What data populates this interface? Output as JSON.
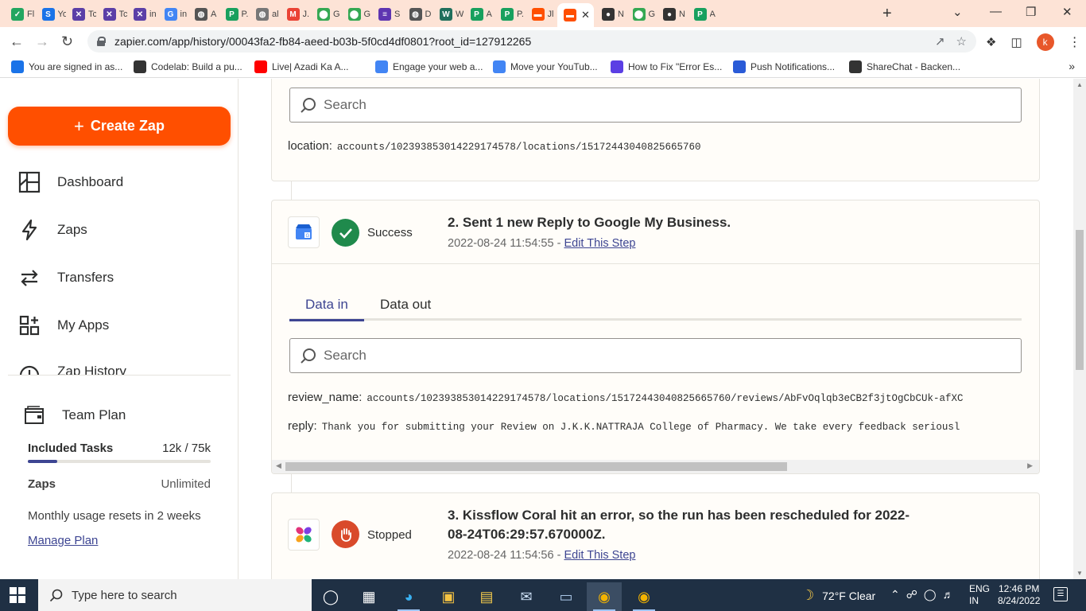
{
  "browser": {
    "tabs": [
      {
        "label": "Fl",
        "icon": "check-icon",
        "color": "#22a660"
      },
      {
        "label": "Yo",
        "icon": "s-logo-icon",
        "color": "#1a73e8"
      },
      {
        "label": "Tc",
        "icon": "crossed-icon",
        "color": "#5b3fa7"
      },
      {
        "label": "Tc",
        "icon": "crossed-icon",
        "color": "#5b3fa7"
      },
      {
        "label": "in",
        "icon": "crossed-icon",
        "color": "#5b3fa7"
      },
      {
        "label": "in",
        "icon": "google-icon",
        "color": "#4285f4"
      },
      {
        "label": "A",
        "icon": "globe-icon",
        "color": "#555555"
      },
      {
        "label": "P.",
        "icon": "p-logo-icon",
        "color": "#18a05e"
      },
      {
        "label": "al",
        "icon": "globe-icon",
        "color": "#777777"
      },
      {
        "label": "J.",
        "icon": "gmail-icon",
        "color": "#ea4335"
      },
      {
        "label": "G",
        "icon": "maps-icon",
        "color": "#34a853"
      },
      {
        "label": "G",
        "icon": "maps-icon",
        "color": "#34a853"
      },
      {
        "label": "S",
        "icon": "list-icon",
        "color": "#5e35b1"
      },
      {
        "label": "D",
        "icon": "globe-icon",
        "color": "#555555"
      },
      {
        "label": "W",
        "icon": "w-logo-icon",
        "color": "#1f6f5c"
      },
      {
        "label": "A",
        "icon": "p-logo-icon",
        "color": "#18a05e"
      },
      {
        "label": "P.",
        "icon": "p-logo-icon",
        "color": "#18a05e"
      },
      {
        "label": "Jl",
        "icon": "zapier-icon",
        "color": "#ff4f00"
      }
    ],
    "active_tab": {
      "icon": "zapier-icon",
      "color": "#ff4f00"
    },
    "tabs_right": [
      {
        "label": "N",
        "icon": "github-icon",
        "color": "#333333"
      },
      {
        "label": "G",
        "icon": "maps-icon",
        "color": "#34a853"
      },
      {
        "label": "N",
        "icon": "github-icon",
        "color": "#333333"
      },
      {
        "label": "A",
        "icon": "p-logo-icon",
        "color": "#18a05e"
      }
    ],
    "url": "zapier.com/app/history/00043fa2-fb84-aeed-b03b-5f0cd4df0801?root_id=127912265",
    "profile_letter": "k",
    "bookmarks": [
      {
        "label": "You are signed in as...",
        "color": "#1a73e8"
      },
      {
        "label": "Codelab: Build a pu...",
        "color": "#333333"
      },
      {
        "label": "Live| Azadi Ka A...",
        "color": "#ff0000"
      },
      {
        "label": "Engage your web a...",
        "color": "#4285f4"
      },
      {
        "label": "Move your YouTub...",
        "color": "#4285f4"
      },
      {
        "label": "How to Fix \"Error Es...",
        "color": "#5b3fe4"
      },
      {
        "label": "Push Notifications...",
        "color": "#2a5bd7"
      },
      {
        "label": "ShareChat - Backen...",
        "color": "#333333"
      }
    ]
  },
  "sidebar": {
    "create_label": "Create Zap",
    "nav": [
      {
        "label": "Dashboard",
        "icon": "dashboard-icon"
      },
      {
        "label": "Zaps",
        "icon": "bolt-icon"
      },
      {
        "label": "Transfers",
        "icon": "transfer-icon"
      },
      {
        "label": "My Apps",
        "icon": "apps-icon"
      },
      {
        "label": "Zap History",
        "icon": "history-icon"
      }
    ],
    "plan": {
      "title": "Team Plan",
      "tasks_label": "Included Tasks",
      "tasks_value": "12k / 75k",
      "tasks_fraction": 0.16,
      "zaps_label": "Zaps",
      "zaps_value": "Unlimited",
      "reset_text": "Monthly usage resets in 2 weeks",
      "manage_label": "Manage Plan"
    }
  },
  "main": {
    "step1": {
      "search_placeholder": "Search",
      "fields": [
        {
          "key": "location:",
          "value": "accounts/102393853014229174578/locations/15172443040825665760"
        }
      ]
    },
    "step2": {
      "status": "Success",
      "title": "2. Sent 1 new Reply to Google My Business.",
      "timestamp": "2022-08-24 11:54:55 - ",
      "edit_label": "Edit This Step",
      "tabs": [
        "Data in",
        "Data out"
      ],
      "search_placeholder": "Search",
      "fields": [
        {
          "key": "review_name:",
          "value": "accounts/102393853014229174578/locations/15172443040825665760/reviews/AbFvOqlqb3eCB2f3jtOgCbCUk-afXC"
        },
        {
          "key": "reply:",
          "value": "Thank you for submitting your Review on J.K.K.NATTRAJA College of Pharmacy. We take every feedback seriousl"
        }
      ]
    },
    "step3": {
      "status": "Stopped",
      "title": "3. Kissflow Coral hit an error, so the run has been rescheduled for 2022-08-24T06:29:57.670000Z.",
      "timestamp": "2022-08-24 11:54:56 - ",
      "edit_label": "Edit This Step"
    }
  },
  "taskbar": {
    "search_placeholder": "Type here to search",
    "weather": "72°F  Clear",
    "lang_line1": "ENG",
    "lang_line2": "IN",
    "time": "12:46 PM",
    "date": "8/24/2022"
  },
  "colors": {
    "accent": "#ff4f00",
    "brand_link": "#3d4592",
    "success": "#1f8a4c",
    "stopped": "#d94a2b"
  }
}
